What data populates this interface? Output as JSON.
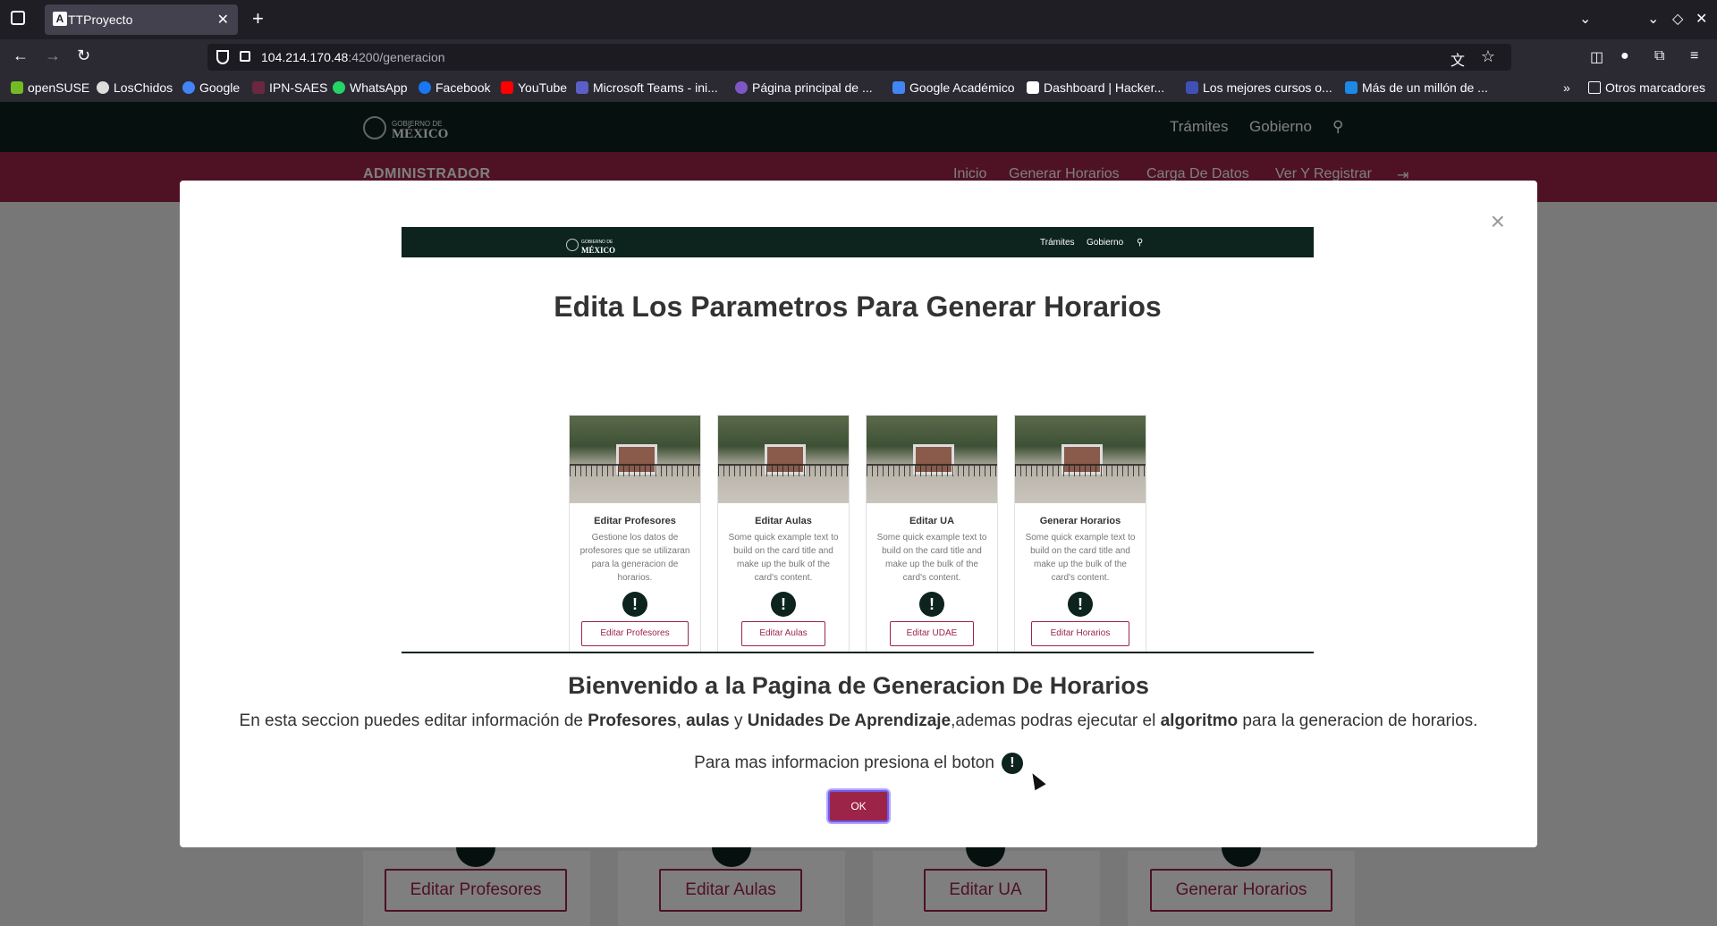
{
  "browser": {
    "tab_title": "TTProyecto",
    "tab_favicon": "A",
    "url_host": "104.214.170.48",
    "url_path": ":4200/generacion",
    "bookmarks": [
      "openSUSE",
      "LosChidos",
      "Google",
      "IPN-SAES",
      "WhatsApp",
      "Facebook",
      "YouTube",
      "Microsoft Teams - ini...",
      "Página principal de ...",
      "Google Académico",
      "Dashboard | Hacker...",
      "Los mejores cursos o...",
      "Más de un millón de ...",
      "Otros marcadores"
    ]
  },
  "site": {
    "logo_small": "GOBIERNO DE",
    "logo_big": "MÉXICO",
    "nav": [
      "Trámites",
      "Gobierno"
    ],
    "admin_title": "ADMINISTRADOR",
    "admin_links": [
      "Inicio",
      "Generar Horarios",
      "Carga De Datos",
      "Ver Y Registrar"
    ],
    "bottom_buttons": [
      "Editar Profesores",
      "Editar Aulas",
      "Editar UA",
      "Generar Horarios"
    ]
  },
  "modal": {
    "close": "×",
    "screenshot": {
      "title": "Edita Los Parametros Para Generar Horarios",
      "cards": [
        {
          "title": "Editar Profesores",
          "text": "Gestione los datos de profesores que se utilizaran para la generacion de horarios.",
          "button": "Editar Profesores"
        },
        {
          "title": "Editar Aulas",
          "text": "Some quick example text to build on the card title and make up the bulk of the card's content.",
          "button": "Editar Aulas"
        },
        {
          "title": "Editar UA",
          "text": "Some quick example text to build on the card title and make up the bulk of the card's content.",
          "button": "Editar UDAE"
        },
        {
          "title": "Generar Horarios",
          "text": "Some quick example text to build on the card title and make up the bulk of the card's content.",
          "button": "Editar Horarios"
        }
      ]
    },
    "welcome": "Bienvenido a la Pagina de Generacion De Horarios",
    "desc_parts": [
      "En esta seccion puedes editar información de ",
      "Profesores",
      ", ",
      "aulas",
      " y ",
      "Unidades De Aprendizaje",
      ",ademas podras ejecutar el ",
      "algoritmo",
      " para la generacion de horarios."
    ],
    "more_info": "Para mas informacion presiona el boton",
    "ok": "OK"
  }
}
